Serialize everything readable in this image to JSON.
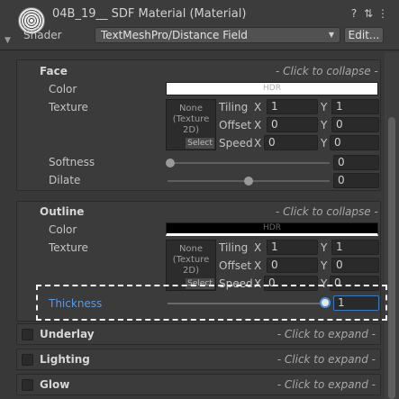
{
  "header": {
    "title": "04B_19__ SDF Material (Material)",
    "shader_label": "Shader",
    "shader_value": "TextMeshPro/Distance Field",
    "edit_label": "Edit...",
    "help_icon": "?",
    "settings_icon": "⇅",
    "menu_icon": "⋮"
  },
  "face": {
    "title": "Face",
    "collapse_hint": "- Click to collapse -",
    "color_label": "Color",
    "color_hdr": "HDR",
    "texture_label": "Texture",
    "texture_none": "None (Texture 2D)",
    "texture_select": "Select",
    "tiling_label": "Tiling",
    "offset_label": "Offset",
    "speed_label": "Speed",
    "x_label": "X",
    "y_label": "Y",
    "tiling_x": "1",
    "tiling_y": "1",
    "offset_x": "0",
    "offset_y": "0",
    "speed_x": "0",
    "speed_y": "0",
    "softness_label": "Softness",
    "softness_value": "0",
    "dilate_label": "Dilate",
    "dilate_value": "0"
  },
  "outline": {
    "title": "Outline",
    "collapse_hint": "- Click to collapse -",
    "color_label": "Color",
    "color_hdr": "HDR",
    "texture_label": "Texture",
    "texture_none": "None (Texture 2D)",
    "texture_select": "Select",
    "tiling_label": "Tiling",
    "offset_label": "Offset",
    "speed_label": "Speed",
    "x_label": "X",
    "y_label": "Y",
    "tiling_x": "1",
    "tiling_y": "1",
    "offset_x": "0",
    "offset_y": "0",
    "speed_x": "0",
    "speed_y": "0",
    "thickness_label": "Thickness",
    "thickness_value": "1"
  },
  "sections": [
    {
      "title": "Underlay",
      "hint": "- Click to expand -"
    },
    {
      "title": "Lighting",
      "hint": "- Click to expand -"
    },
    {
      "title": "Glow",
      "hint": "- Click to expand -"
    }
  ],
  "colors": {
    "face_color": "#ffffff",
    "outline_color": "#000000",
    "accent_blue": "#4a8fd9",
    "highlight_border": "#f2f2f2"
  }
}
